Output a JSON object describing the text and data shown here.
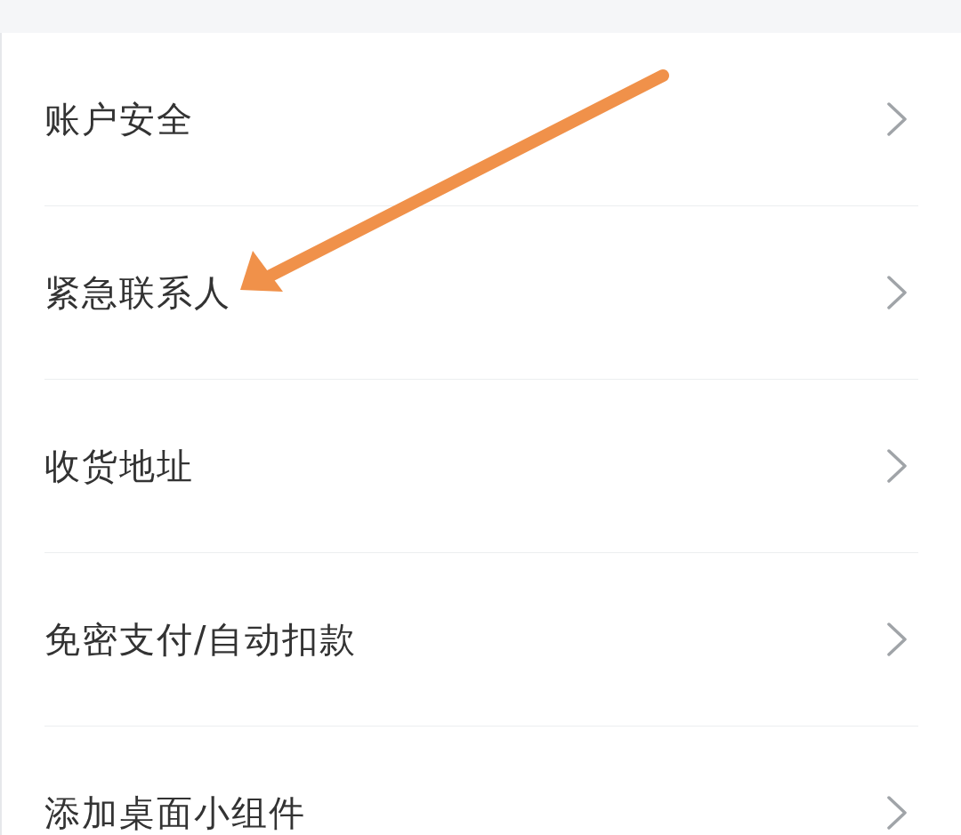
{
  "settings_list": [
    {
      "label": "账户安全"
    },
    {
      "label": "紧急联系人"
    },
    {
      "label": "收货地址"
    },
    {
      "label": "免密支付/自动扣款"
    },
    {
      "label": "添加桌面小组件"
    }
  ]
}
